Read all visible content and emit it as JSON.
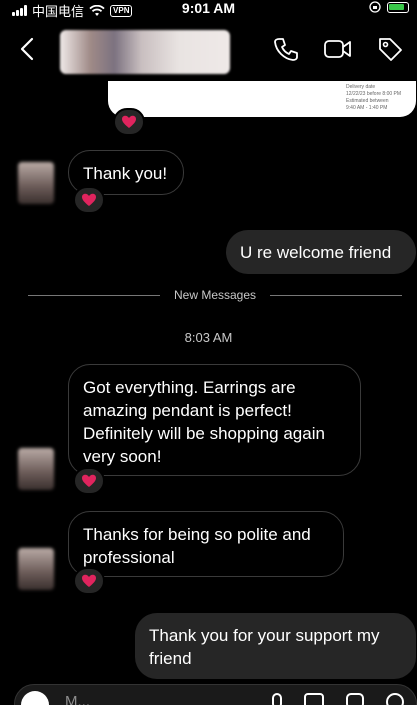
{
  "status_bar": {
    "carrier": "中国电信",
    "vpn": "VPN",
    "time": "9:01 AM"
  },
  "header": {
    "back_icon": "chevron-left-icon",
    "actions": [
      "phone-icon",
      "video-icon",
      "tag-icon"
    ]
  },
  "preview_card": {
    "lines": [
      "Delivery date",
      "12/22/23 before 8:00 PM",
      "Estimated between",
      "9:40 AM - 1:40 PM"
    ]
  },
  "messages": [
    {
      "direction": "incoming",
      "text": "Thank you!",
      "reaction": "❤"
    },
    {
      "direction": "outgoing",
      "text": "U re welcome friend"
    },
    {
      "direction": "incoming",
      "text": "Got everything. Earrings are amazing pendant is perfect! Definitely will be shopping again very soon!",
      "reaction": "❤"
    },
    {
      "direction": "incoming",
      "text": "Thanks for being so polite and professional",
      "reaction": "❤"
    },
    {
      "direction": "outgoing",
      "text": "Thank you for your support my friend"
    }
  ],
  "divider_label": "New Messages",
  "timestamp": "8:03 AM",
  "top_reaction": "❤",
  "composer": {
    "placeholder": "M..."
  },
  "colors": {
    "background": "#000000",
    "outgoing_bubble": "#262626",
    "heart": "#e0245e"
  }
}
